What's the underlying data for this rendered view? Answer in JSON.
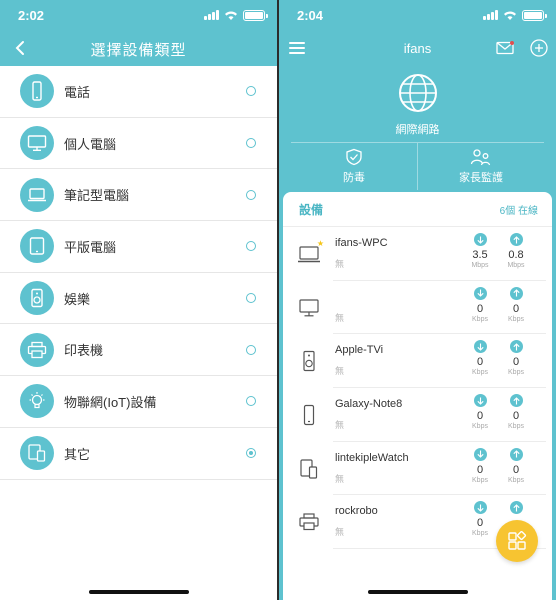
{
  "left": {
    "status": {
      "time": "2:02"
    },
    "header": {
      "title": "選擇設備類型"
    },
    "items": [
      {
        "label": "電話",
        "icon": "phone-icon",
        "selected": false
      },
      {
        "label": "個人電腦",
        "icon": "monitor-icon",
        "selected": false
      },
      {
        "label": "筆記型電腦",
        "icon": "laptop-icon",
        "selected": false
      },
      {
        "label": "平版電腦",
        "icon": "tablet-icon",
        "selected": false
      },
      {
        "label": "娛樂",
        "icon": "speaker-icon",
        "selected": false
      },
      {
        "label": "印表機",
        "icon": "printer-icon",
        "selected": false
      },
      {
        "label": "物聯網(IoT)設備",
        "icon": "lightbulb-icon",
        "selected": false
      },
      {
        "label": "其它",
        "icon": "devices-icon",
        "selected": true
      }
    ]
  },
  "right": {
    "status": {
      "time": "2:04"
    },
    "header": {
      "title": "ifans"
    },
    "internet": {
      "label": "網際網路"
    },
    "actions": [
      {
        "label": "防毒",
        "icon": "shield-icon"
      },
      {
        "label": "家長監護",
        "icon": "parental-icon"
      }
    ],
    "devices": {
      "title": "設備",
      "online": "6個 在線",
      "list": [
        {
          "name": "ifans-WPC",
          "cn": "無",
          "icon": "laptop-icon",
          "starred": true,
          "down": "3.5",
          "down_unit": "Mbps",
          "up": "0.8",
          "up_unit": "Mbps"
        },
        {
          "name": "",
          "cn": "無",
          "icon": "monitor-icon",
          "starred": false,
          "down": "0",
          "down_unit": "Kbps",
          "up": "0",
          "up_unit": "Kbps"
        },
        {
          "name": "Apple-TVi",
          "cn": "無",
          "icon": "speaker-icon",
          "starred": false,
          "down": "0",
          "down_unit": "Kbps",
          "up": "0",
          "up_unit": "Kbps"
        },
        {
          "name": "Galaxy-Note8",
          "cn": "無",
          "icon": "phone-icon",
          "starred": false,
          "down": "0",
          "down_unit": "Kbps",
          "up": "0",
          "up_unit": "Kbps"
        },
        {
          "name": "lintekipleWatch",
          "cn": "無",
          "icon": "devices-icon",
          "starred": false,
          "down": "0",
          "down_unit": "Kbps",
          "up": "0",
          "up_unit": "Kbps"
        },
        {
          "name": "rockrobo",
          "cn": "無",
          "icon": "printer-icon",
          "starred": false,
          "down": "0",
          "down_unit": "Kbps",
          "up": null,
          "up_unit": null
        }
      ]
    }
  },
  "colors": {
    "accent": "#5ec2cf",
    "fab": "#f7c431"
  }
}
